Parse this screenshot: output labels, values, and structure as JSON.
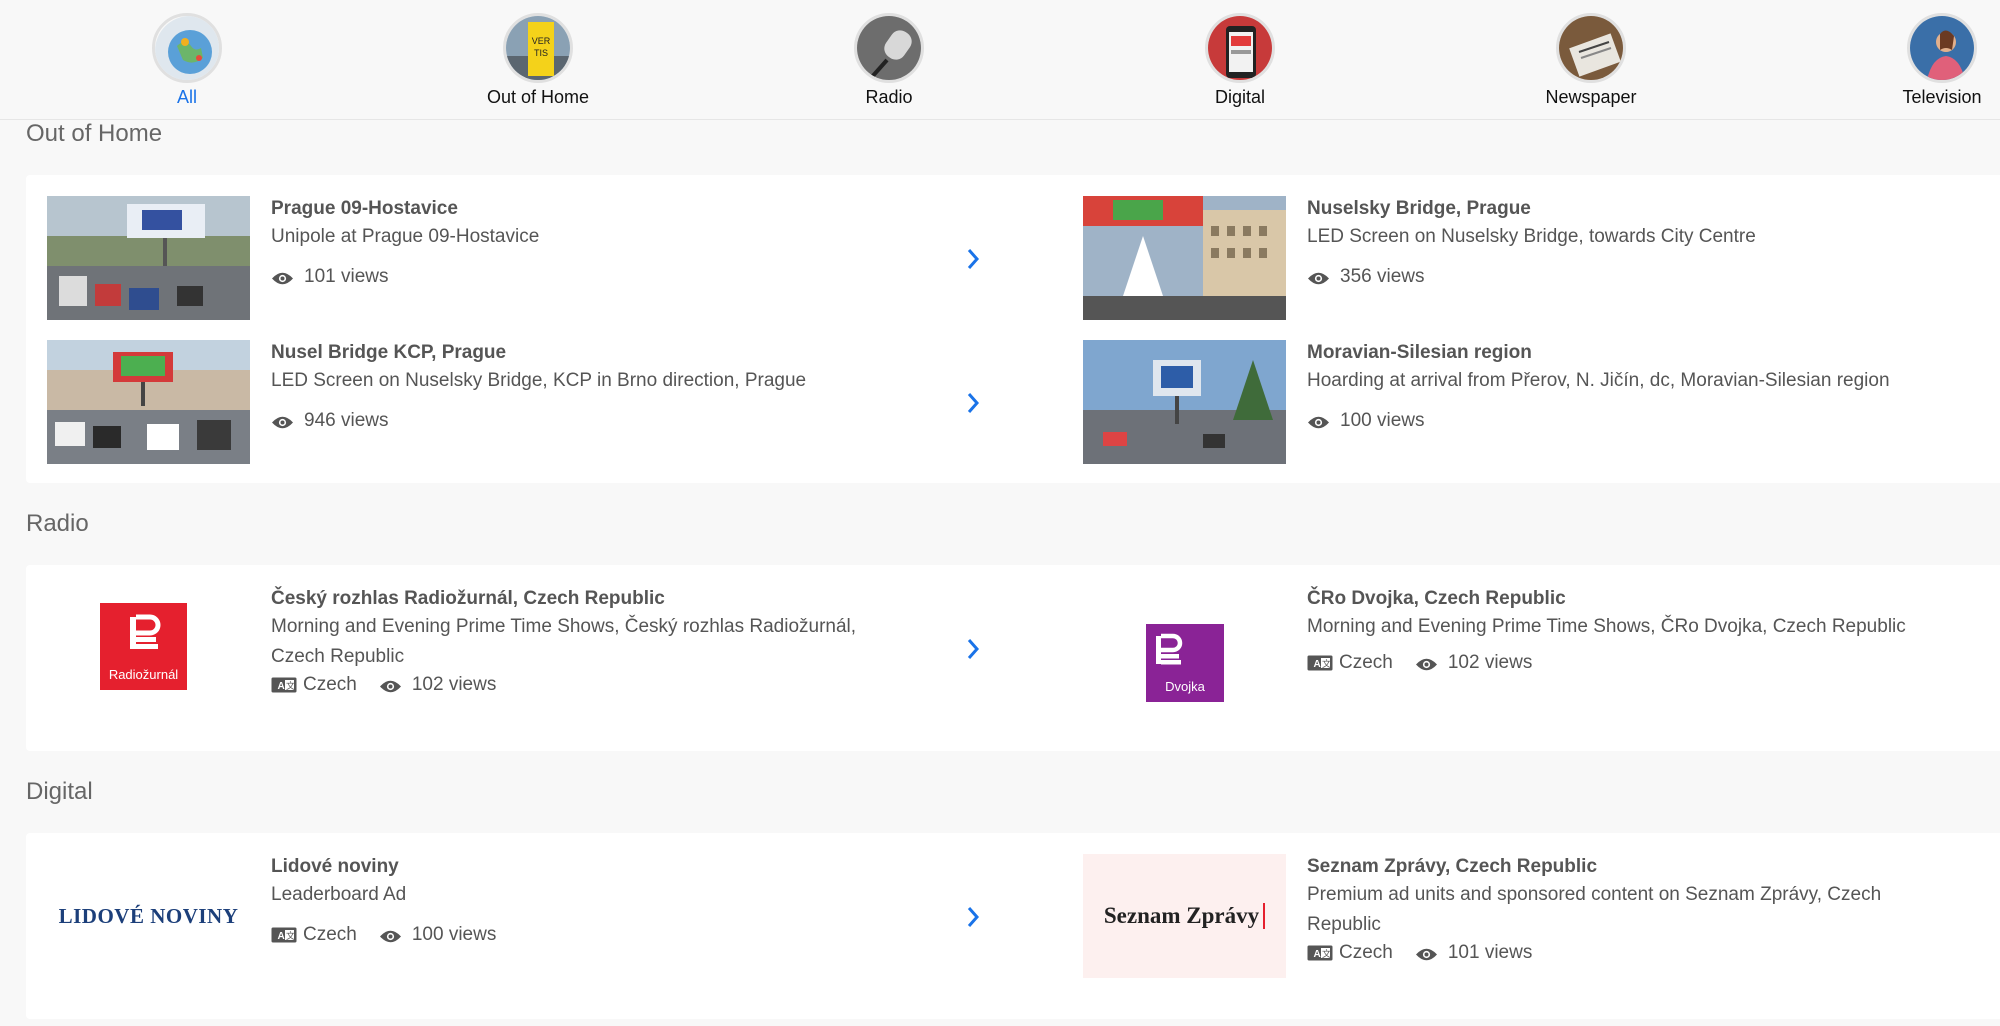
{
  "nav": {
    "categories": [
      {
        "label": "All",
        "icon": "globe-icon"
      },
      {
        "label": "Out of Home",
        "icon": "billboard-icon"
      },
      {
        "label": "Radio",
        "icon": "microphone-icon"
      },
      {
        "label": "Digital",
        "icon": "smartphone-icon"
      },
      {
        "label": "Newspaper",
        "icon": "newspaper-icon"
      },
      {
        "label": "Television",
        "icon": "tv-presenter-icon"
      }
    ],
    "active_color": "#1a73e8"
  },
  "sections": {
    "ooh": {
      "title": "Out of Home",
      "items": [
        {
          "title": "Prague 09-Hostavice",
          "desc": "Unipole at Prague 09-Hostavice",
          "views": "101 views"
        },
        {
          "title": "Nuselsky Bridge, Prague",
          "desc": "LED Screen on Nuselsky Bridge, towards City Centre",
          "views": "356 views"
        },
        {
          "title": "Nusel Bridge KCP, Prague",
          "desc": "LED Screen on Nuselsky Bridge, KCP in Brno direction, Prague",
          "views": "946 views"
        },
        {
          "title": "Moravian-Silesian region",
          "desc": "Hoarding at arrival from Přerov, N. Jičín, dc, Moravian-Silesian region",
          "views": "100 views"
        }
      ]
    },
    "radio": {
      "title": "Radio",
      "items": [
        {
          "title": "Český rozhlas Radiožurnál, Czech Republic",
          "desc": "Morning and Evening Prime Time Shows, Český rozhlas Radiožurnál, Czech Republic",
          "language": "Czech",
          "views": "102 views",
          "logo_text": "Radiožurnál",
          "logo_color": "#e5202e"
        },
        {
          "title": "ČRo Dvojka, Czech Republic",
          "desc": "Morning and Evening Prime Time Shows, ČRo Dvojka, Czech Republic",
          "language": "Czech",
          "views": "102 views",
          "logo_text": "Dvojka",
          "logo_color": "#8a2396"
        }
      ]
    },
    "digital": {
      "title": "Digital",
      "items": [
        {
          "title": "Lidové noviny",
          "desc": "Leaderboard Ad",
          "language": "Czech",
          "views": "100 views",
          "logo_text": "LIDOVÉ NOVINY"
        },
        {
          "title": "Seznam Zprávy, Czech Republic",
          "desc": "Premium ad units and sponsored content on Seznam Zprávy, Czech Republic",
          "language": "Czech",
          "views": "101 views",
          "logo_text": "Seznam Zprávy"
        }
      ]
    }
  }
}
